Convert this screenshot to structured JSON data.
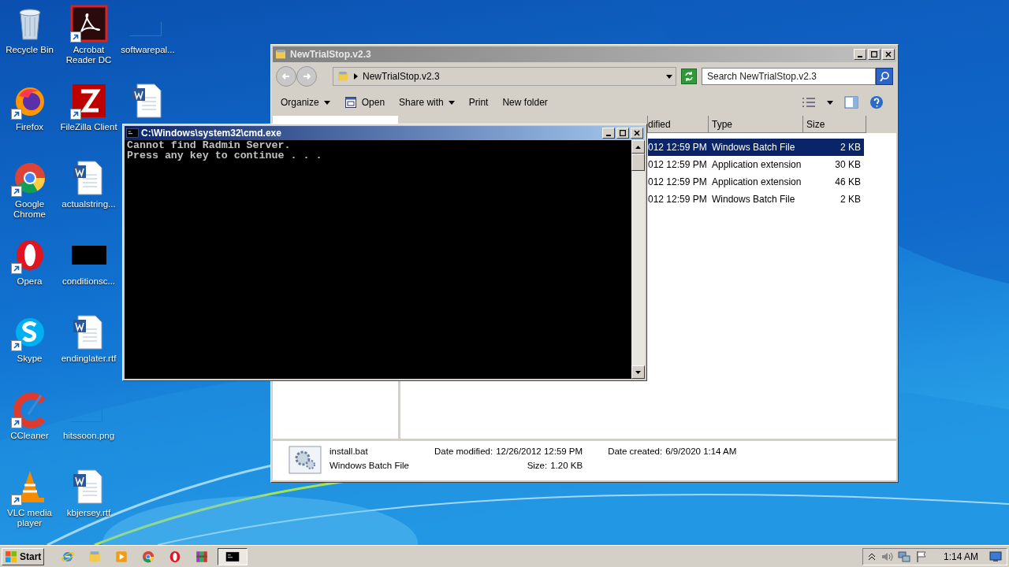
{
  "desktop_icons": [
    {
      "label": "Recycle Bin",
      "kind": "recycle",
      "shortcut": false
    },
    {
      "label": "Firefox",
      "kind": "firefox",
      "shortcut": true
    },
    {
      "label": "Google Chrome",
      "kind": "chrome",
      "shortcut": true
    },
    {
      "label": "Opera",
      "kind": "opera",
      "shortcut": true
    },
    {
      "label": "Skype",
      "kind": "skype",
      "shortcut": true
    },
    {
      "label": "CCleaner",
      "kind": "ccleaner",
      "shortcut": true
    },
    {
      "label": "VLC media player",
      "kind": "vlc",
      "shortcut": true
    },
    {
      "label": "Acrobat Reader DC",
      "kind": "acrobat",
      "shortcut": true
    },
    {
      "label": "FileZilla Client",
      "kind": "filezilla",
      "shortcut": true
    },
    {
      "label": "actualstring...",
      "kind": "word",
      "shortcut": false
    },
    {
      "label": "conditionsc...",
      "kind": "dark",
      "shortcut": false
    },
    {
      "label": "endinglater.rtf",
      "kind": "word",
      "shortcut": false
    },
    {
      "label": "hitssoon.png",
      "kind": "faint",
      "shortcut": false
    },
    {
      "label": "kbjersey.rtf",
      "kind": "word",
      "shortcut": false
    },
    {
      "label": "softwarepal...",
      "kind": "faint",
      "shortcut": false
    },
    {
      "kind": "word",
      "shortcut": false
    }
  ],
  "explorer": {
    "title": "NewTrialStop.v2.3",
    "address": "NewTrialStop.v2.3",
    "search_placeholder": "Search NewTrialStop.v2.3",
    "toolbar": [
      {
        "label": "Organize",
        "kind": "menu"
      },
      {
        "label": "Open",
        "kind": "open"
      },
      {
        "label": "Share with",
        "kind": "menu"
      },
      {
        "label": "Print",
        "kind": "plain"
      },
      {
        "label": "New folder",
        "kind": "plain"
      }
    ],
    "columns": [
      "dified",
      "Type",
      "Size"
    ],
    "rows": [
      {
        "date": "012 12:59 PM",
        "type": "Windows Batch File",
        "size": "2 KB",
        "selected": true
      },
      {
        "date": "012 12:59 PM",
        "type": "Application extension",
        "size": "30 KB",
        "selected": false
      },
      {
        "date": "012 12:59 PM",
        "type": "Application extension",
        "size": "46 KB",
        "selected": false
      },
      {
        "date": "012 12:59 PM",
        "type": "Windows Batch File",
        "size": "2 KB",
        "selected": false
      }
    ],
    "details": {
      "name": "install.bat",
      "type": "Windows Batch File",
      "fields": [
        {
          "label": "Date modified:",
          "value": "12/26/2012 12:59 PM"
        },
        {
          "label": "Date created:",
          "value": "6/9/2020 1:14 AM"
        },
        {
          "label": "Size:",
          "value": "1.20 KB"
        }
      ]
    }
  },
  "console": {
    "title": "C:\\Windows\\system32\\cmd.exe",
    "lines": [
      "Cannot find Radmin Server.",
      "Press any key to continue . . ."
    ]
  },
  "taskbar": {
    "start": "Start",
    "apps": [
      {
        "kind": "ie",
        "active": false
      },
      {
        "kind": "folder",
        "active": false
      },
      {
        "kind": "media",
        "active": false
      },
      {
        "kind": "chrome",
        "active": false
      },
      {
        "kind": "opera",
        "active": false
      },
      {
        "kind": "winrar",
        "active": false
      },
      {
        "kind": "cmd",
        "active": true
      }
    ],
    "clock": "1:14 AM"
  }
}
